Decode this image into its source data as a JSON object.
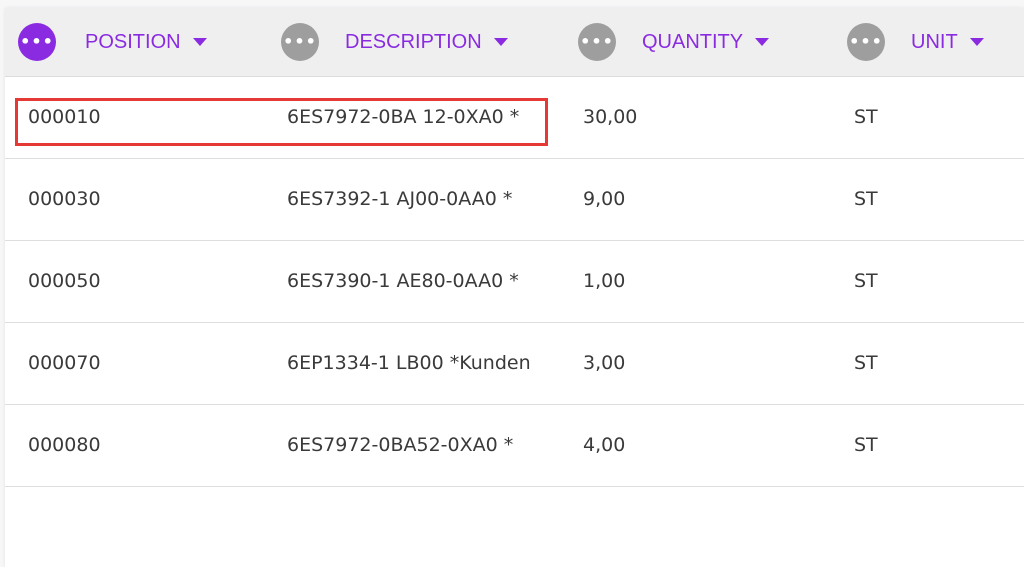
{
  "header": {
    "columns": [
      {
        "label": "POSITION",
        "menu_icon": "more-horizontal-icon",
        "menu_active": true,
        "sort_icon": "caret-down-icon"
      },
      {
        "label": "DESCRIPTION",
        "menu_icon": "more-horizontal-icon",
        "menu_active": false,
        "sort_icon": "caret-down-icon"
      },
      {
        "label": "QUANTITY",
        "menu_icon": "more-horizontal-icon",
        "menu_active": false,
        "sort_icon": "caret-down-icon"
      },
      {
        "label": "UNIT",
        "menu_icon": "more-horizontal-icon",
        "menu_active": false,
        "sort_icon": "caret-down-icon"
      }
    ],
    "menu_glyph": "•••"
  },
  "rows": [
    {
      "position": "000010",
      "description": "6ES7972-0BA 12-0XA0 *",
      "quantity": "30,00",
      "unit": "ST",
      "highlighted": true
    },
    {
      "position": "000030",
      "description": "6ES7392-1 AJ00-0AA0 *",
      "quantity": "9,00",
      "unit": "ST",
      "highlighted": false
    },
    {
      "position": "000050",
      "description": "6ES7390-1 AE80-0AA0 *",
      "quantity": "1,00",
      "unit": "ST",
      "highlighted": false
    },
    {
      "position": "000070",
      "description": "6EP1334-1 LB00 *Kunden",
      "quantity": "3,00",
      "unit": "ST",
      "highlighted": false
    },
    {
      "position": "000080",
      "description": "6ES7972-0BA52-0XA0 *",
      "quantity": "4,00",
      "unit": "ST",
      "highlighted": false
    }
  ],
  "colors": {
    "accent": "#8a2be2",
    "menu_inactive": "#9e9e9e",
    "highlight_border": "#e53935",
    "header_bg": "#efefef",
    "text": "#3a3a3a"
  }
}
